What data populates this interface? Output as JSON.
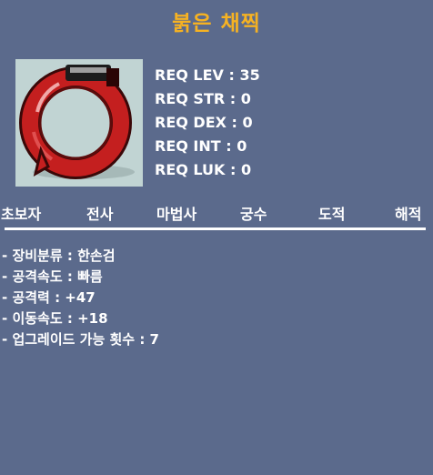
{
  "item": {
    "name": "붉은 채찍",
    "icon": "red-whip-icon",
    "name_color": "#f6b222"
  },
  "requirements": [
    "REQ LEV : 35",
    "REQ STR : 0",
    "REQ DEX : 0",
    "REQ INT : 0",
    "REQ LUK : 0"
  ],
  "jobs": [
    "초보자",
    "전사",
    "마법사",
    "궁수",
    "도적",
    "해적"
  ],
  "stats": [
    "- 장비분류 : 한손검",
    "- 공격속도 : 빠름",
    "- 공격력 : +47",
    "- 이동속도 : +18",
    "- 업그레이드 가능 횟수 : 7"
  ],
  "colors": {
    "background": "#5b6a8c",
    "title": "#f6b222",
    "icon_bg": "#c1d4d3",
    "whip_red": "#c41f1f"
  }
}
